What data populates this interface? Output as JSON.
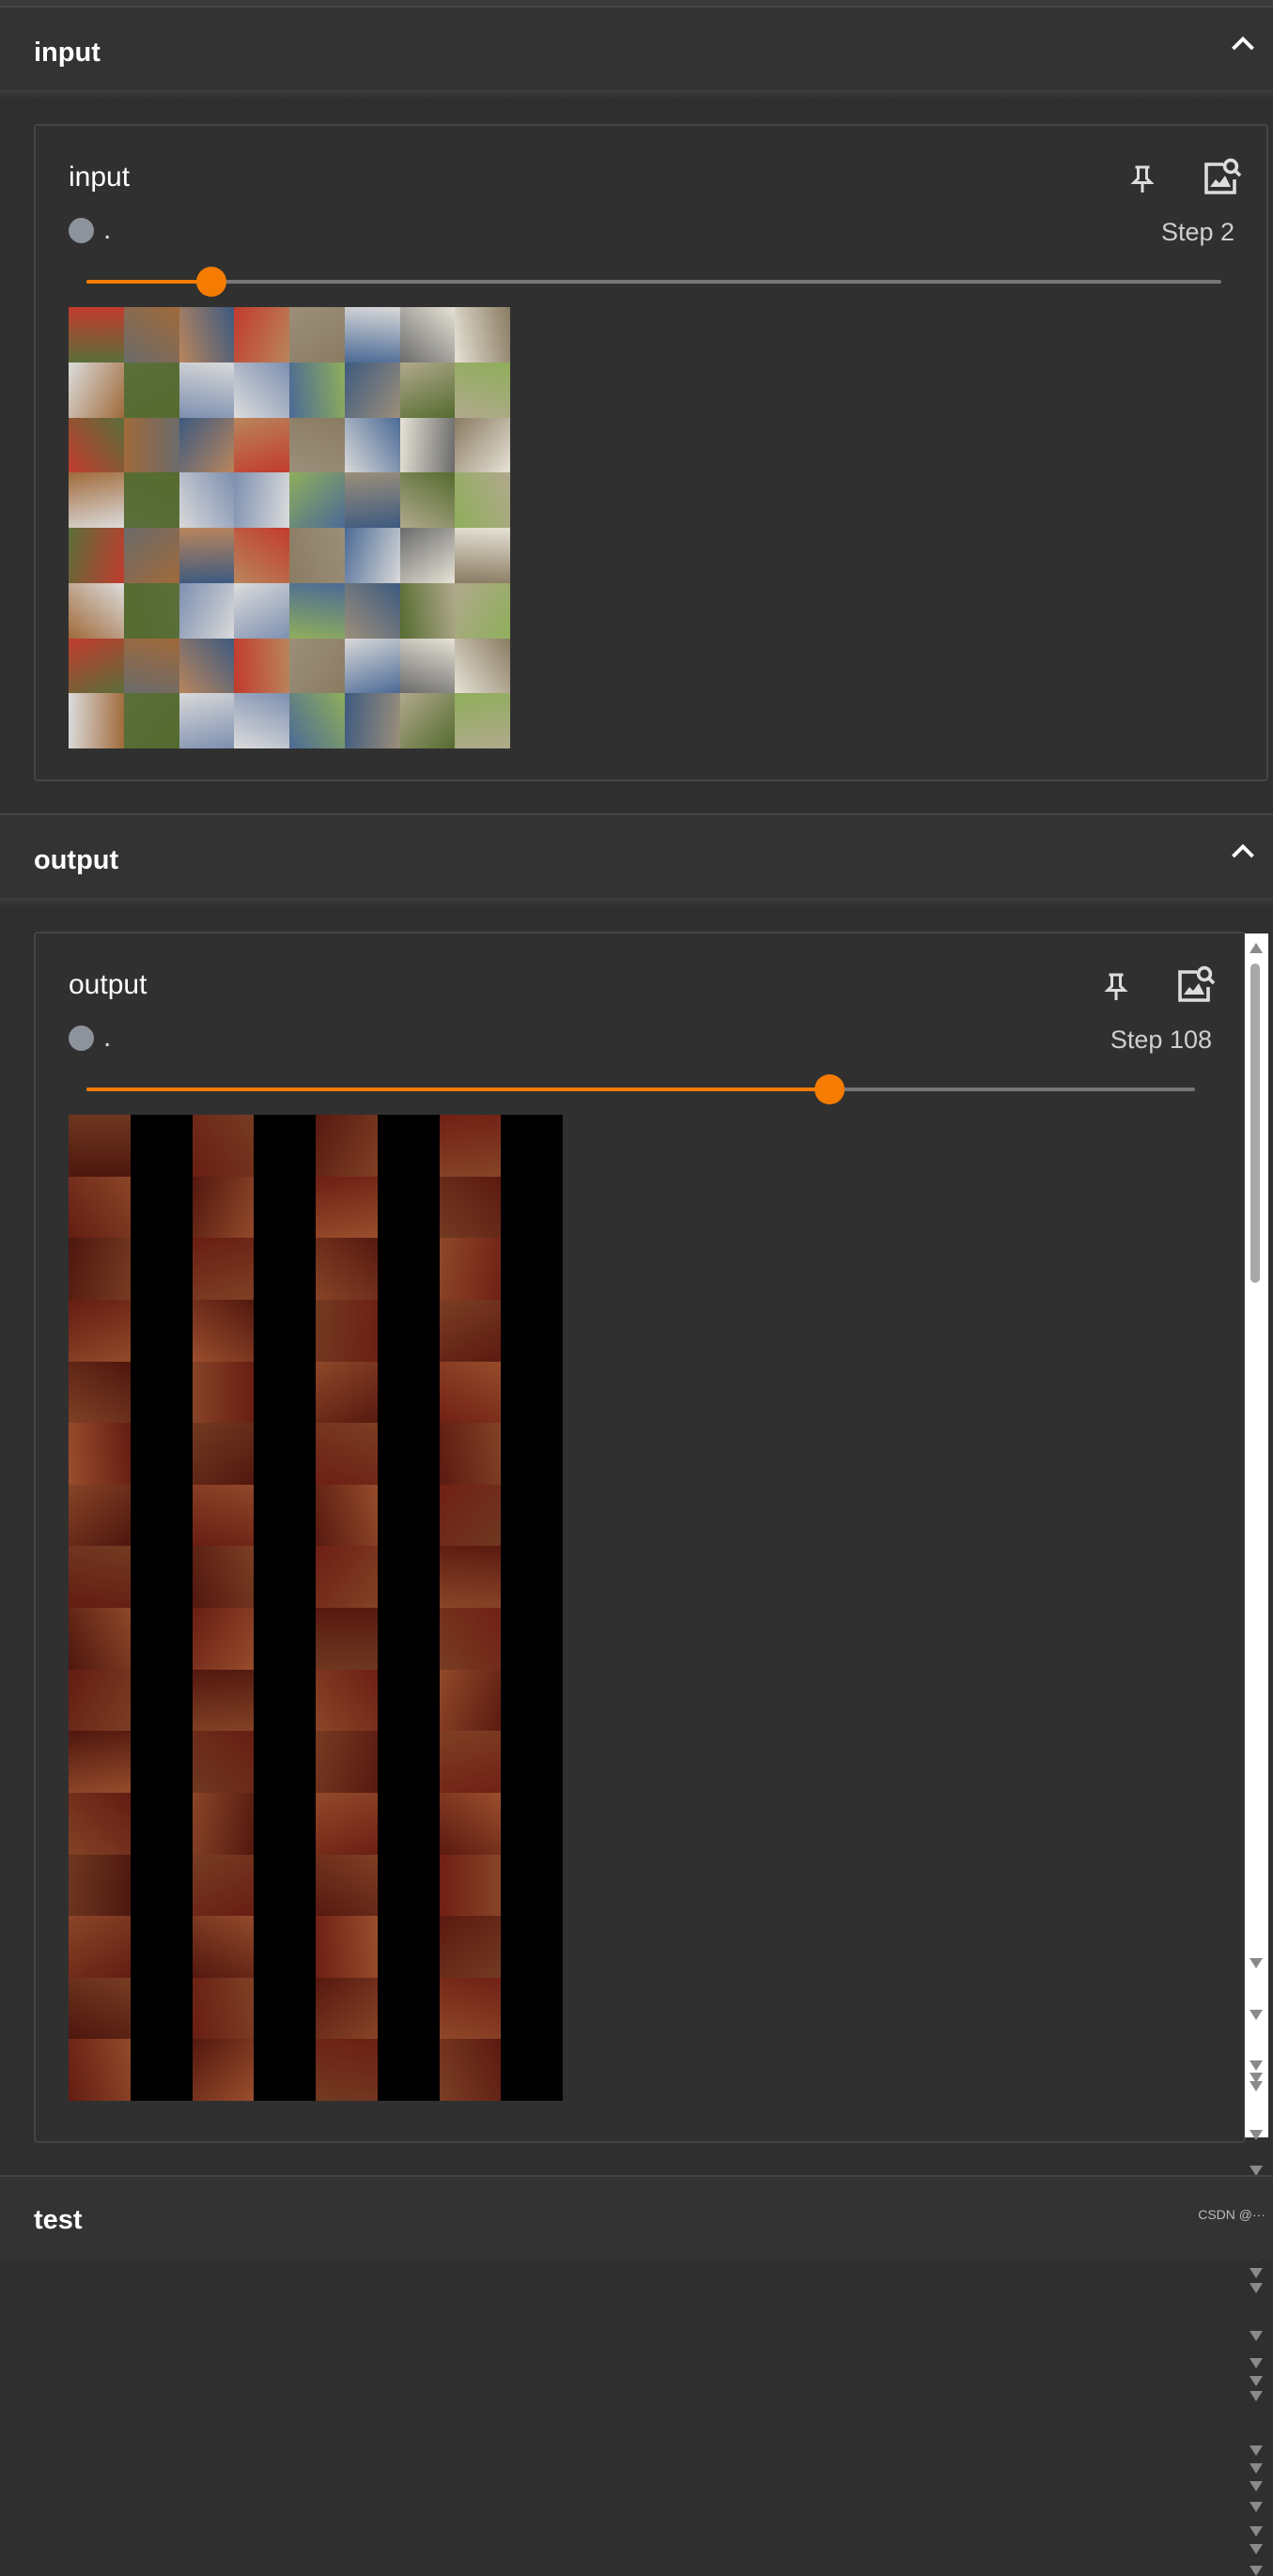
{
  "groups": [
    {
      "title": "input",
      "card": {
        "title": "input",
        "run": ".",
        "step": "Step 2",
        "slider_fraction": 0.11
      }
    },
    {
      "title": "output",
      "card": {
        "title": "output",
        "run": ".",
        "step": "Step 108",
        "slider_fraction": 0.67
      }
    },
    {
      "title": "test"
    }
  ],
  "icons": {
    "pin": "pin-icon",
    "image_zoom": "image-search-icon",
    "collapse": "chevron-up-icon"
  },
  "colors": {
    "accent": "#f57c00",
    "run_dot": "#8d939b",
    "background": "#2f2f2f"
  },
  "watermark": "CSDN @···"
}
